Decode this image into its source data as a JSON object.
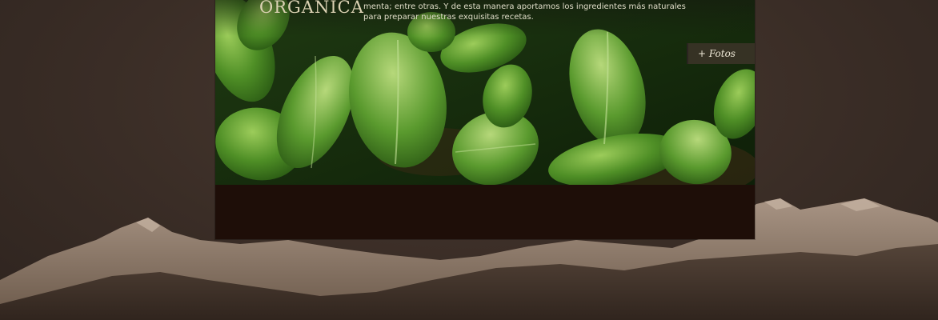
{
  "hero": {
    "title": "ORGANICA",
    "description": "menta; entre otras. Y de esta manera aportamos los ingredientes más naturales para preparar nuestras exquisitas recetas.",
    "photos_link": "+ Fotos"
  },
  "colors": {
    "background": "#3a2d26",
    "panel": "#1e0e08",
    "title": "#dcd2b4"
  }
}
